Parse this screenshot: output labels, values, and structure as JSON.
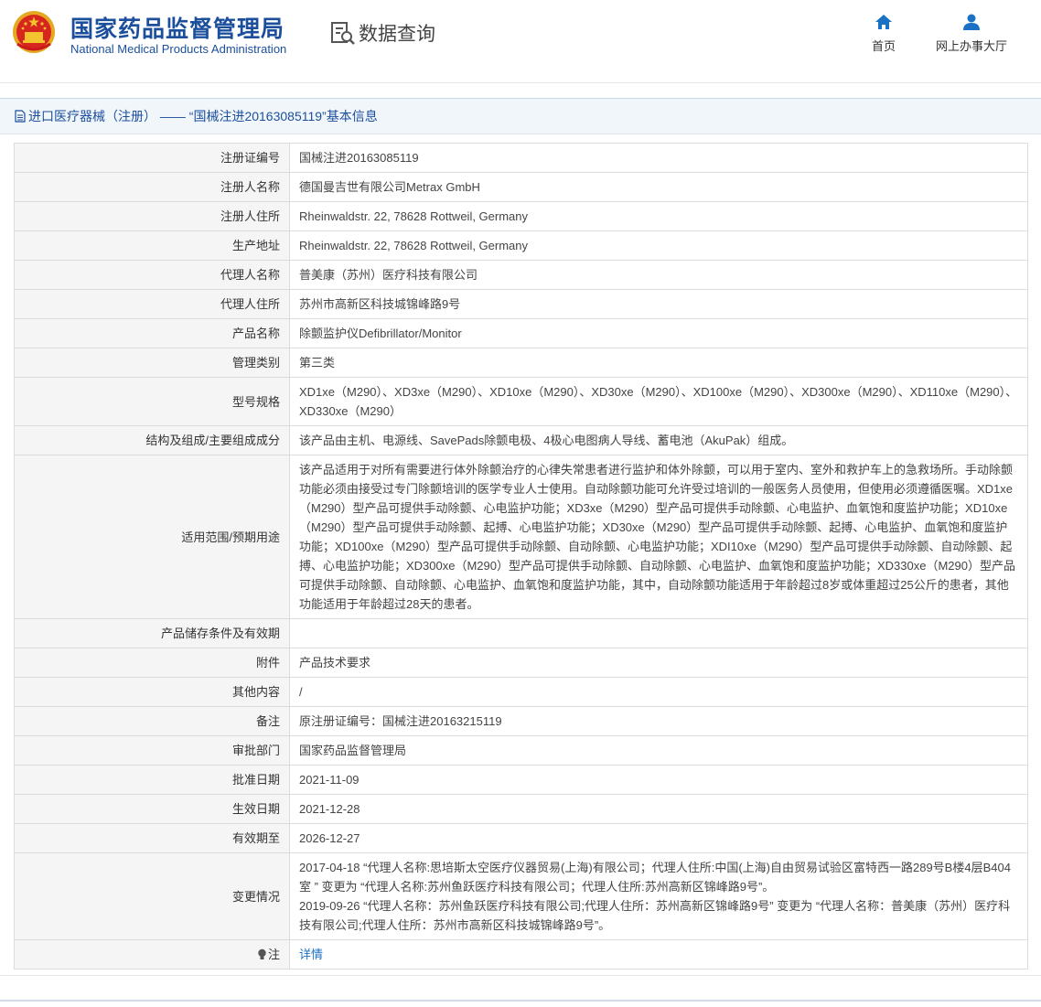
{
  "header": {
    "title_cn": "国家药品监督管理局",
    "title_en": "National Medical Products Administration",
    "query_label": "数据查询",
    "nav": {
      "home": "首页",
      "hall": "网上办事大厅"
    }
  },
  "panel": {
    "title": "进口医疗器械（注册） —— “国械注进20163085119”基本信息"
  },
  "rows": [
    {
      "label": "注册证编号",
      "value": "国械注进20163085119"
    },
    {
      "label": "注册人名称",
      "value": "德国曼吉世有限公司Metrax GmbH"
    },
    {
      "label": "注册人住所",
      "value": "Rheinwaldstr. 22, 78628 Rottweil, Germany"
    },
    {
      "label": "生产地址",
      "value": "Rheinwaldstr. 22, 78628 Rottweil, Germany"
    },
    {
      "label": "代理人名称",
      "value": "普美康（苏州）医疗科技有限公司"
    },
    {
      "label": "代理人住所",
      "value": "苏州市高新区科技城锦峰路9号"
    },
    {
      "label": "产品名称",
      "value": "除颤监护仪Defibrillator/Monitor"
    },
    {
      "label": "管理类别",
      "value": "第三类"
    },
    {
      "label": "型号规格",
      "value": "XD1xe（M290）、XD3xe（M290）、XD10xe（M290）、XD30xe（M290）、XD100xe（M290）、XD300xe（M290）、XD110xe（M290）、XD330xe（M290）"
    },
    {
      "label": "结构及组成/主要组成成分",
      "value": "该产品由主机、电源线、SavePads除颤电极、4极心电图病人导线、蓄电池（AkuPak）组成。"
    },
    {
      "label": "适用范围/预期用途",
      "value": "该产品适用于对所有需要进行体外除颤治疗的心律失常患者进行监护和体外除颤，可以用于室内、室外和救护车上的急救场所。手动除颤功能必须由接受过专门除颤培训的医学专业人士使用。自动除颤功能可允许受过培训的一般医务人员使用，但使用必须遵循医嘱。XD1xe（M290）型产品可提供手动除颤、心电监护功能；XD3xe（M290）型产品可提供手动除颤、心电监护、血氧饱和度监护功能；XD10xe（M290）型产品可提供手动除颤、起搏、心电监护功能；XD30xe（M290）型产品可提供手动除颤、起搏、心电监护、血氧饱和度监护功能；XD100xe（M290）型产品可提供手动除颤、自动除颤、心电监护功能；XDI10xe（M290）型产品可提供手动除颤、自动除颤、起搏、心电监护功能；XD300xe（M290）型产品可提供手动除颤、自动除颤、心电监护、血氧饱和度监护功能；XD330xe（M290）型产品可提供手动除颤、自动除颤、心电监护、血氧饱和度监护功能，其中，自动除颤功能适用于年龄超过8岁或体重超过25公斤的患者，其他功能适用于年龄超过28天的患者。"
    },
    {
      "label": "产品储存条件及有效期",
      "value": ""
    },
    {
      "label": "附件",
      "value": "产品技术要求"
    },
    {
      "label": "其他内容",
      "value": "/"
    },
    {
      "label": "备注",
      "value": "原注册证编号：国械注进20163215119"
    },
    {
      "label": "审批部门",
      "value": "国家药品监督管理局"
    },
    {
      "label": "批准日期",
      "value": "2021-11-09"
    },
    {
      "label": "生效日期",
      "value": "2021-12-28"
    },
    {
      "label": "有效期至",
      "value": "2026-12-27"
    }
  ],
  "changes": {
    "label": "变更情况",
    "line1": "2017-04-18 “代理人名称:思培斯太空医疗仪器贸易(上海)有限公司；代理人住所:中国(上海)自由贸易试验区富特西一路289号B楼4层B404室 ” 变更为 “代理人名称:苏州鱼跃医疗科技有限公司；代理人住所:苏州高新区锦峰路9号”。",
    "line2": "2019-09-26 “代理人名称：苏州鱼跃医疗科技有限公司;代理人住所：苏州高新区锦峰路9号” 变更为 “代理人名称：普美康（苏州）医疗科技有限公司;代理人住所：苏州市高新区科技城锦峰路9号”。"
  },
  "note": {
    "label": "注",
    "link": "详情"
  },
  "colors": {
    "brand_blue": "#1b4f9c",
    "link_blue": "#1b72c4",
    "label_bg": "#f5f5f5",
    "head_bg": "#f1f6fb"
  }
}
